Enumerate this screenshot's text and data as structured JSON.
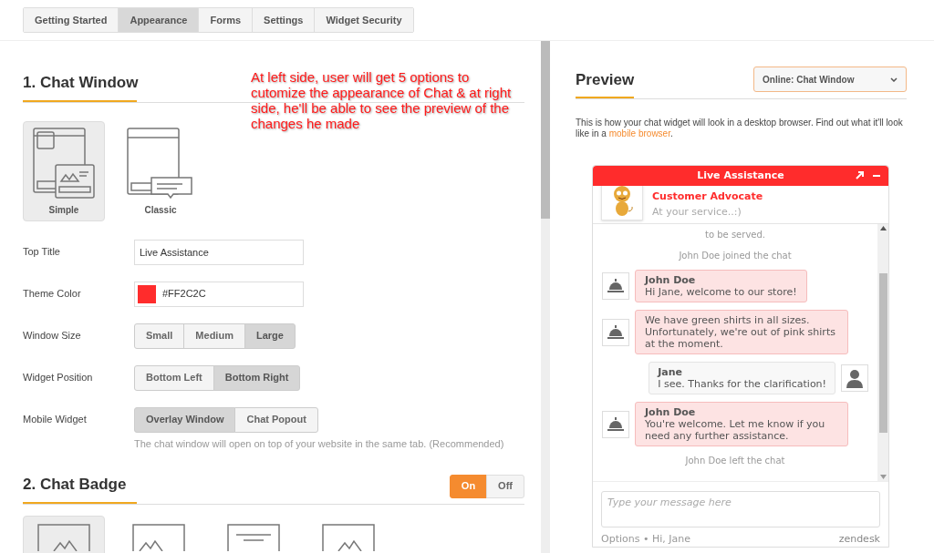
{
  "tabs": [
    {
      "label": "Getting Started",
      "selected": false
    },
    {
      "label": "Appearance",
      "selected": true
    },
    {
      "label": "Forms",
      "selected": false
    },
    {
      "label": "Settings",
      "selected": false
    },
    {
      "label": "Widget Security",
      "selected": false
    }
  ],
  "annotation": "At left side, user will get 5 options to cutomize the appearance of Chat & at right side, he'll be able to see the preview of the changes he made",
  "chat_window": {
    "heading": "1. Chat Window",
    "layouts": [
      {
        "label": "Simple",
        "selected": true
      },
      {
        "label": "Classic",
        "selected": false
      }
    ],
    "fields": [
      {
        "kind": "text",
        "label": "Top Title",
        "value": "Live Assistance"
      },
      {
        "kind": "color",
        "label": "Theme Color",
        "value": "#FF2C2C",
        "color": "#ff2c2c"
      },
      {
        "kind": "segmented",
        "label": "Window Size",
        "options": [
          {
            "label": "Small",
            "selected": false
          },
          {
            "label": "Medium",
            "selected": false
          },
          {
            "label": "Large",
            "selected": true
          }
        ]
      },
      {
        "kind": "segmented",
        "label": "Widget Position",
        "options": [
          {
            "label": "Bottom Left",
            "selected": false
          },
          {
            "label": "Bottom Right",
            "selected": true
          }
        ]
      },
      {
        "kind": "segmented",
        "label": "Mobile Widget",
        "options": [
          {
            "label": "Overlay Window",
            "selected": true
          },
          {
            "label": "Chat Popout",
            "selected": false
          }
        ],
        "hint": "The chat window will open on top of your website in the same tab. (Recommended)"
      }
    ]
  },
  "chat_badge": {
    "heading": "2. Chat Badge",
    "toggle": [
      {
        "label": "On",
        "selected": true
      },
      {
        "label": "Off",
        "selected": false
      }
    ],
    "styles": [
      {
        "selected": true
      },
      {
        "selected": false
      },
      {
        "selected": false
      },
      {
        "selected": false
      }
    ]
  },
  "preview": {
    "heading": "Preview",
    "dropdown": "Online: Chat Window",
    "description": "This is how your chat widget will look in a desktop browser. Find out what it'll look like in a ",
    "link": "mobile browser",
    "description_end": ".",
    "widget": {
      "title": "Live Assistance",
      "agent_name": "Customer Advocate",
      "agent_tagline": "At your service..:)",
      "messages": [
        {
          "kind": "system",
          "text": "to be served."
        },
        {
          "kind": "system",
          "text": "John Doe joined the chat"
        },
        {
          "kind": "agent",
          "name": "John Doe",
          "text": "Hi Jane, welcome to our store!"
        },
        {
          "kind": "agent",
          "text": "We have green shirts in all sizes. Unfortunately, we're out of pink shirts at the moment."
        },
        {
          "kind": "visitor",
          "name": "Jane",
          "text": "I see. Thanks for the clarification!"
        },
        {
          "kind": "agent",
          "name": "John Doe",
          "text": "You're welcome. Let me know if you need any further assistance."
        },
        {
          "kind": "system",
          "text": "John Doe left the chat"
        }
      ],
      "input_placeholder": "Type your message here",
      "footer": "Options • Hi, Jane",
      "brand": "zendesk"
    }
  }
}
